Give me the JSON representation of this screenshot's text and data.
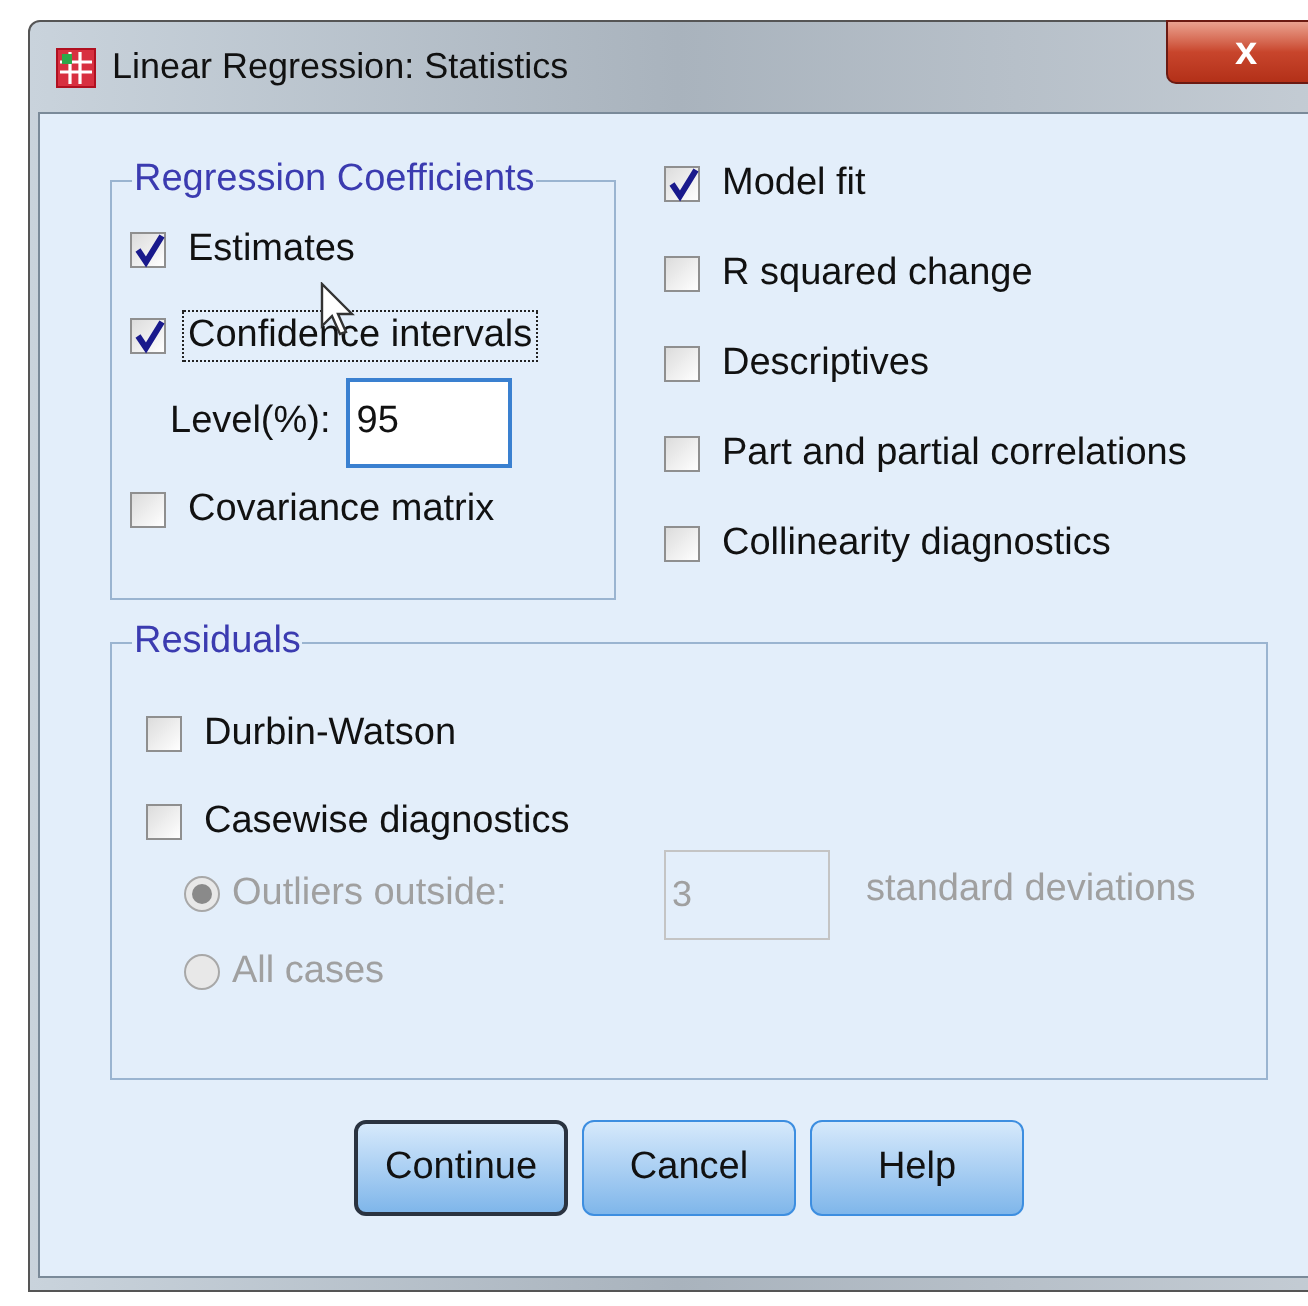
{
  "window": {
    "title": "Linear Regression: Statistics",
    "close": "x"
  },
  "regression_coefficients": {
    "title": "Regression Coefficients",
    "items": [
      {
        "kind": "checkbox",
        "label": "Estimates",
        "checked": true,
        "focused": false
      },
      {
        "kind": "checkbox",
        "label": "Confidence intervals",
        "checked": true,
        "focused": true
      },
      {
        "kind": "field",
        "label": "Level(%):",
        "value": "95"
      },
      {
        "kind": "checkbox",
        "label": "Covariance matrix",
        "checked": false,
        "focused": false
      }
    ]
  },
  "options": [
    {
      "label": "Model fit",
      "checked": true
    },
    {
      "label": "R squared change",
      "checked": false
    },
    {
      "label": "Descriptives",
      "checked": false
    },
    {
      "label": "Part and partial correlations",
      "checked": false
    },
    {
      "label": "Collinearity diagnostics",
      "checked": false
    }
  ],
  "residuals": {
    "title": "Residuals",
    "checkboxes": [
      {
        "label": "Durbin-Watson",
        "checked": false
      },
      {
        "label": "Casewise diagnostics",
        "checked": false
      }
    ],
    "radios": [
      {
        "label": "Outliers outside:",
        "selected": true,
        "disabled": true,
        "field": "3",
        "suffix": "standard deviations"
      },
      {
        "label": "All cases",
        "selected": false,
        "disabled": true
      }
    ]
  },
  "buttons": [
    {
      "label": "Continue",
      "default": true
    },
    {
      "label": "Cancel",
      "default": false
    },
    {
      "label": "Help",
      "default": false
    }
  ]
}
